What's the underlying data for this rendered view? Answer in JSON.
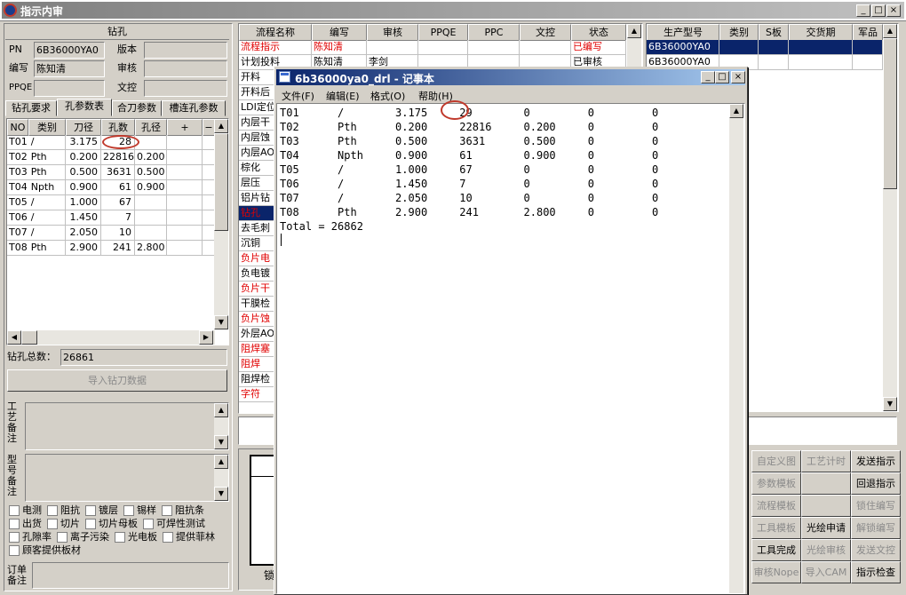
{
  "app": {
    "title": "指示内审"
  },
  "drill_section": {
    "header": "钻孔",
    "pn_label": "PN",
    "pn_value": "6B36000YA0",
    "version_label": "版本",
    "version_value": "",
    "author_label": "编写",
    "author_value": "陈知清",
    "review_label": "审核",
    "review_value": "",
    "ppqe_label": "PPQE",
    "ppqe_value": "",
    "doc_control_label": "文控",
    "doc_control_value": ""
  },
  "tabs": [
    "钻孔要求",
    "孔参数表",
    "合刀参数",
    "槽连孔参数"
  ],
  "tool_table": {
    "headers": [
      "NO",
      "类别",
      "刀径",
      "孔数",
      "孔径",
      "+",
      "−"
    ],
    "rows": [
      [
        "T01",
        "/",
        "3.175",
        "28",
        ""
      ],
      [
        "T02",
        "Pth",
        "0.200",
        "22816",
        "0.200"
      ],
      [
        "T03",
        "Pth",
        "0.500",
        "3631",
        "0.500"
      ],
      [
        "T04",
        "Npth",
        "0.900",
        "61",
        "0.900"
      ],
      [
        "T05",
        "/",
        "1.000",
        "67",
        ""
      ],
      [
        "T06",
        "/",
        "1.450",
        "7",
        ""
      ],
      [
        "T07",
        "/",
        "2.050",
        "10",
        ""
      ],
      [
        "T08",
        "Pth",
        "2.900",
        "241",
        "2.800"
      ]
    ]
  },
  "total": {
    "label": "钻孔总数：",
    "value": "26861"
  },
  "import_button": "导入钻刀数据",
  "notes": {
    "process_label": "工艺备注",
    "model_label": "型号备注"
  },
  "checkboxes": [
    [
      "电测",
      "阻抗",
      "镀层",
      "锡样",
      "阻抗条"
    ],
    [
      "出货",
      "切片",
      "切片母板",
      "可焊性测试"
    ],
    [
      "孔隙率",
      "离子污染",
      "光电板",
      "提供菲林"
    ],
    [
      "顾客提供板材"
    ]
  ],
  "order_note_label": "订单备注",
  "flow_table": {
    "headers": [
      "流程名称",
      "编写",
      "审核",
      "PPQE",
      "PPC",
      "文控",
      "状态"
    ],
    "rows": [
      {
        "name": "流程指示",
        "author": "陈知清",
        "review": "",
        "status": "已编写",
        "red": true
      },
      {
        "name": "计划投料",
        "author": "陈知清",
        "review": "李剑",
        "status": "已审核",
        "red": false
      },
      {
        "name": "开料",
        "red": false
      },
      {
        "name": "开料后",
        "red": false
      },
      {
        "name": "LDI定位",
        "red": false
      },
      {
        "name": "内层干",
        "red": false
      },
      {
        "name": "内层蚀",
        "red": false
      },
      {
        "name": "内层AOI",
        "red": false
      },
      {
        "name": "棕化",
        "red": false
      },
      {
        "name": "层压",
        "red": false
      },
      {
        "name": "铝片钻",
        "red": false
      },
      {
        "name": "钻孔",
        "red": true,
        "highlight": true
      },
      {
        "name": "去毛刺",
        "red": false
      },
      {
        "name": "沉铜",
        "red": false
      },
      {
        "name": "负片电",
        "red": true
      },
      {
        "name": "负电镀",
        "red": false
      },
      {
        "name": "负片干",
        "red": true
      },
      {
        "name": "干膜检",
        "red": false
      },
      {
        "name": "负片蚀",
        "red": true
      },
      {
        "name": "外层AOI",
        "red": false
      },
      {
        "name": "阻焊塞",
        "red": true
      },
      {
        "name": "阻焊",
        "red": true
      },
      {
        "name": "阻焊检",
        "red": false
      },
      {
        "name": "字符",
        "red": true
      }
    ]
  },
  "product_table": {
    "headers": [
      "生产型号",
      "类别",
      "S板",
      "交货期",
      "军品"
    ],
    "rows": [
      "6B36000YA0",
      "6B36000YA0"
    ]
  },
  "action_buttons": [
    [
      "自定义图",
      "工艺计时",
      "发送指示"
    ],
    [
      "参数模板",
      "",
      "回退指示"
    ],
    [
      "流程模板",
      "",
      "锁住编写"
    ],
    [
      "工具模板",
      "光绘申请",
      "解锁编写"
    ],
    [
      "工具完成",
      "光绘审核",
      "发送文控"
    ],
    [
      "审核Nope",
      "导入CAM",
      "指示检查"
    ]
  ],
  "action_disabled": [
    [
      true,
      true,
      false
    ],
    [
      true,
      true,
      false
    ],
    [
      true,
      true,
      true
    ],
    [
      true,
      false,
      true
    ],
    [
      false,
      true,
      true
    ],
    [
      true,
      true,
      false
    ]
  ],
  "notepad": {
    "title": "6b36000ya0_drl - 记事本",
    "menu": [
      "文件(F)",
      "编辑(E)",
      "格式(O)",
      "帮助(H)"
    ],
    "lines": [
      "T01      /        3.175     29        0         0         0",
      "T02      Pth      0.200     22816     0.200     0         0",
      "T03      Pth      0.500     3631      0.500     0         0",
      "T04      Npth     0.900     61        0.900     0         0",
      "T05      /        1.000     67        0         0         0",
      "T06      /        1.450     7         0         0         0",
      "T07      /        2.050     10        0         0         0",
      "T08      Pth      2.900     241       2.800     0         0",
      "Total = 26862"
    ]
  },
  "colors": {
    "selection": "#0a246a",
    "red_text": "#e00000",
    "annotation": "#c0392b"
  }
}
